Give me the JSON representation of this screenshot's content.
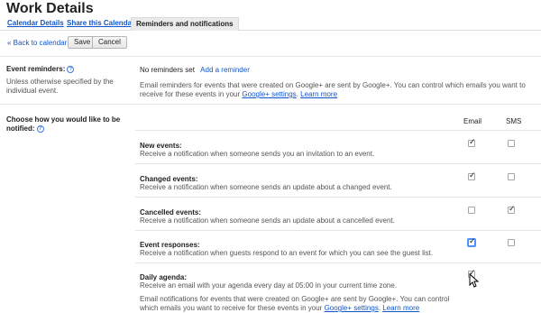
{
  "page": {
    "title": "Work Details"
  },
  "tabs": [
    {
      "label": "Calendar Details",
      "active": false
    },
    {
      "label": "Share this Calendar",
      "active": false
    },
    {
      "label": "Reminders and notifications",
      "active": true
    }
  ],
  "toolbar": {
    "back_label": "« Back to calendar",
    "save_label": "Save",
    "cancel_label": "Cancel"
  },
  "event_reminders": {
    "label": "Event reminders:",
    "description": "Unless otherwise specified by the individual event.",
    "none_text": "No reminders set",
    "add_label": "Add a reminder",
    "info_text": "Email reminders for events that were created on Google+ are sent by Google+. You can control which emails you want to receive for these events in your",
    "settings_link": "Google+ settings",
    "learn_more": "Learn more"
  },
  "notifications": {
    "label": "Choose how you would like to be notified:",
    "columns": {
      "email": "Email",
      "sms": "SMS"
    },
    "rows": [
      {
        "title": "New events:",
        "desc": "Receive a notification when someone sends you an invitation to an event.",
        "email": true,
        "sms": false
      },
      {
        "title": "Changed events:",
        "desc": "Receive a notification when someone sends an update about a changed event.",
        "email": true,
        "sms": false
      },
      {
        "title": "Cancelled events:",
        "desc": "Receive a notification when someone sends an update about a cancelled event.",
        "email": false,
        "sms": true
      },
      {
        "title": "Event responses:",
        "desc": "Receive a notification when guests respond to an event for which you can see the guest list.",
        "email": true,
        "sms": false
      },
      {
        "title": "Daily agenda:",
        "desc": "Receive an email with your agenda every day at 05:00 in your current time zone.",
        "email": true,
        "sms": null
      }
    ],
    "footer_text": "Email notifications for events that were created on Google+ are sent by Google+. You can control which emails you want to receive for these events in your",
    "footer_link": "Google+ settings",
    "footer_learn_more": "Learn more"
  },
  "icons": {
    "help": "help-circle-icon",
    "cursor": "mouse-pointer-icon"
  },
  "colors": {
    "link": "#1155cc",
    "active_tab_bg": "#ebebeb",
    "focus": "#4d90fe"
  }
}
